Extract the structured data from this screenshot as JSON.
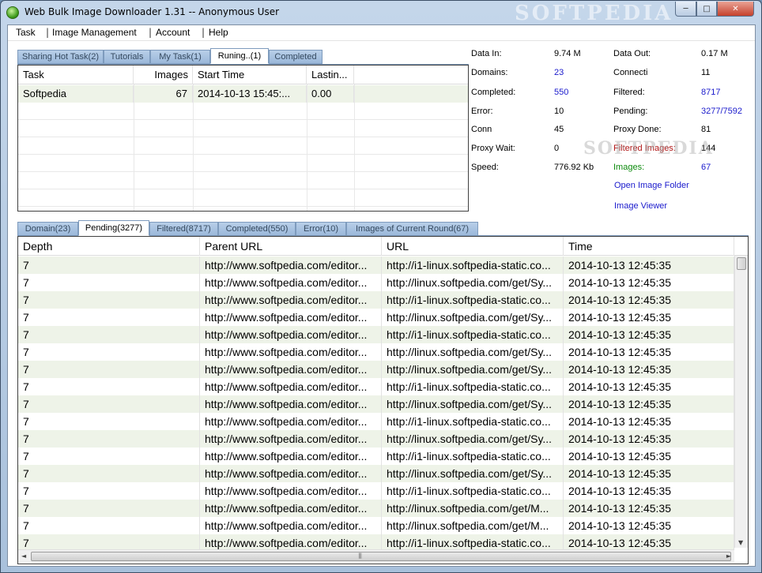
{
  "window": {
    "title": "Web Bulk Image Downloader 1.31 -- Anonymous User",
    "watermark": "SOFTPEDIA",
    "min_glyph": "─",
    "max_glyph": "□",
    "close_glyph": "✕"
  },
  "menu": {
    "items": [
      "Task",
      "Image Management",
      "Account",
      "Help"
    ],
    "separator": "|"
  },
  "task_tabs": [
    "Sharing Hot Task(2)",
    "Tutorials",
    "My Task(1)",
    "Runing..(1)",
    "Completed"
  ],
  "task_tabs_active": 3,
  "task_table": {
    "columns": [
      "Task",
      "Images",
      "Start Time",
      "Lastin..."
    ],
    "rows": [
      [
        "Softpedia",
        "67",
        "2014-10-13 15:45:...",
        "0.00"
      ]
    ]
  },
  "stats": {
    "left": [
      {
        "label": "Data In:",
        "value": "9.74 M"
      },
      {
        "label": "Domains:",
        "value": "23"
      },
      {
        "label": "Completed:",
        "value": "550"
      },
      {
        "label": "Error:",
        "value": "10"
      },
      {
        "label": "Conn",
        "value": "45"
      },
      {
        "label": "Proxy Wait:",
        "value": "0"
      },
      {
        "label": "Speed:",
        "value": "776.92 Kb"
      }
    ],
    "right": [
      {
        "label": "Data Out:",
        "value": "0.17 M"
      },
      {
        "label": "Connecti",
        "value": "11"
      },
      {
        "label": "Filtered:",
        "value": "8717"
      },
      {
        "label": "Pending:",
        "value": "3277/7592"
      },
      {
        "label": "Proxy Done:",
        "value": "81"
      },
      {
        "label": "Filtered Images:",
        "value": "144"
      },
      {
        "label": "Images:",
        "value": "67"
      }
    ],
    "links": [
      "Open Image Folder",
      "Image Viewer"
    ],
    "watermark": "SOFTPEDIA",
    "colors": {
      "blue": "#1a1acc",
      "red": "#b01515",
      "green": "#0d8a0d"
    }
  },
  "bottom_tabs": [
    "Domain(23)",
    "Pending(3277)",
    "Filtered(8717)",
    "Completed(550)",
    "Error(10)",
    "Images of Current Round(67)"
  ],
  "bottom_tabs_active": 1,
  "pending_table": {
    "columns": [
      "Depth",
      "Parent URL",
      "URL",
      "Time"
    ],
    "rows": [
      [
        "7",
        "http://www.softpedia.com/editor...",
        "http://i1-linux.softpedia-static.co...",
        "2014-10-13 12:45:35"
      ],
      [
        "7",
        "http://www.softpedia.com/editor...",
        "http://linux.softpedia.com/get/Sy...",
        "2014-10-13 12:45:35"
      ],
      [
        "7",
        "http://www.softpedia.com/editor...",
        "http://i1-linux.softpedia-static.co...",
        "2014-10-13 12:45:35"
      ],
      [
        "7",
        "http://www.softpedia.com/editor...",
        "http://linux.softpedia.com/get/Sy...",
        "2014-10-13 12:45:35"
      ],
      [
        "7",
        "http://www.softpedia.com/editor...",
        "http://i1-linux.softpedia-static.co...",
        "2014-10-13 12:45:35"
      ],
      [
        "7",
        "http://www.softpedia.com/editor...",
        "http://linux.softpedia.com/get/Sy...",
        "2014-10-13 12:45:35"
      ],
      [
        "7",
        "http://www.softpedia.com/editor...",
        "http://linux.softpedia.com/get/Sy...",
        "2014-10-13 12:45:35"
      ],
      [
        "7",
        "http://www.softpedia.com/editor...",
        "http://i1-linux.softpedia-static.co...",
        "2014-10-13 12:45:35"
      ],
      [
        "7",
        "http://www.softpedia.com/editor...",
        "http://linux.softpedia.com/get/Sy...",
        "2014-10-13 12:45:35"
      ],
      [
        "7",
        "http://www.softpedia.com/editor...",
        "http://i1-linux.softpedia-static.co...",
        "2014-10-13 12:45:35"
      ],
      [
        "7",
        "http://www.softpedia.com/editor...",
        "http://linux.softpedia.com/get/Sy...",
        "2014-10-13 12:45:35"
      ],
      [
        "7",
        "http://www.softpedia.com/editor...",
        "http://i1-linux.softpedia-static.co...",
        "2014-10-13 12:45:35"
      ],
      [
        "7",
        "http://www.softpedia.com/editor...",
        "http://linux.softpedia.com/get/Sy...",
        "2014-10-13 12:45:35"
      ],
      [
        "7",
        "http://www.softpedia.com/editor...",
        "http://i1-linux.softpedia-static.co...",
        "2014-10-13 12:45:35"
      ],
      [
        "7",
        "http://www.softpedia.com/editor...",
        "http://linux.softpedia.com/get/M...",
        "2014-10-13 12:45:35"
      ],
      [
        "7",
        "http://www.softpedia.com/editor...",
        "http://linux.softpedia.com/get/M...",
        "2014-10-13 12:45:35"
      ],
      [
        "7",
        "http://www.softpedia.com/editor...",
        "http://i1-linux.softpedia-static.co...",
        "2014-10-13 12:45:35"
      ]
    ]
  },
  "scroll": {
    "up_glyph": "▲",
    "down_glyph": "▼",
    "left_glyph": "◄",
    "right_glyph": "►",
    "grip_glyph": "|||"
  }
}
